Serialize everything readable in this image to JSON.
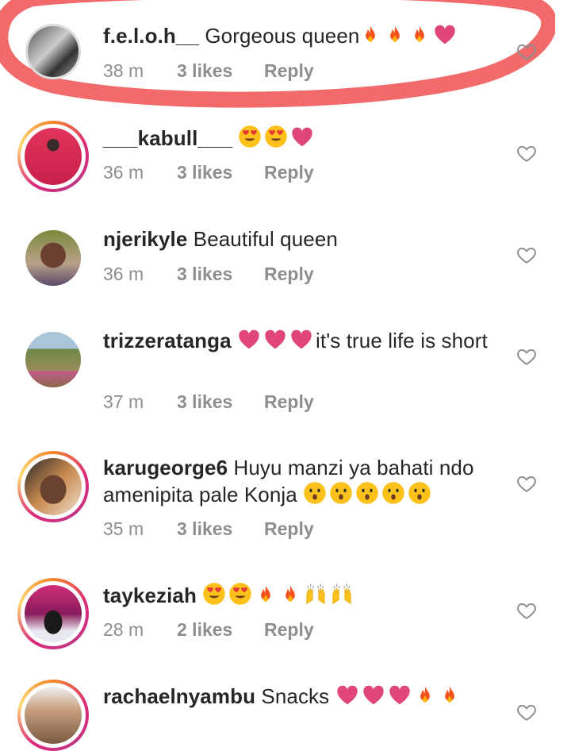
{
  "comments": [
    {
      "username": "f.e.l.o.h__",
      "text": "Gorgeous queen",
      "emojis": [
        "fire-emoji",
        "fire-emoji",
        "fire-emoji",
        "pink-heart-emoji"
      ],
      "time": "38 m",
      "likes": "3 likes",
      "reply": "Reply",
      "avatar_icon": "profile-photo-bw"
    },
    {
      "username": "___kabull___",
      "text": "",
      "emojis": [
        "heart-eyes-emoji",
        "heart-eyes-emoji",
        "pink-heart-emoji"
      ],
      "time": "36 m",
      "likes": "3 likes",
      "reply": "Reply",
      "avatar_icon": "profile-photo-pink"
    },
    {
      "username": "njerikyle",
      "text": "Beautiful queen",
      "emojis": [],
      "time": "36 m",
      "likes": "3 likes",
      "reply": "Reply",
      "avatar_icon": "profile-photo-selfie"
    },
    {
      "username": "trizzeratanga",
      "text_before": "",
      "emojis": [
        "pink-heart-emoji",
        "pink-heart-emoji",
        "pink-heart-emoji"
      ],
      "text": "it's true life is short",
      "time": "37 m",
      "likes": "3 likes",
      "reply": "Reply",
      "avatar_icon": "profile-photo-outdoor"
    },
    {
      "username": "karugeorge6",
      "text": "Huyu manzi ya bahati  ndo amenipita pale Konja",
      "emojis": [
        "hushed-face-emoji",
        "hushed-face-emoji",
        "hushed-face-emoji",
        "hushed-face-emoji",
        "hushed-face-emoji"
      ],
      "time": "35 m",
      "likes": "3 likes",
      "reply": "Reply",
      "avatar_icon": "profile-photo-man"
    },
    {
      "username": "taykeziah",
      "text": "",
      "emojis": [
        "heart-eyes-emoji",
        "heart-eyes-emoji",
        "fire-emoji",
        "fire-emoji",
        "raising-hands-emoji",
        "raising-hands-emoji"
      ],
      "time": "28 m",
      "likes": "2 likes",
      "reply": "Reply",
      "avatar_icon": "profile-photo-purple"
    },
    {
      "username": "rachaelnyambu",
      "text": "Snacks",
      "emojis": [
        "pink-heart-emoji",
        "pink-heart-emoji",
        "pink-heart-emoji",
        "fire-emoji",
        "fire-emoji"
      ],
      "time": "",
      "likes": "",
      "reply": "",
      "avatar_icon": "profile-photo-group"
    }
  ],
  "colors": {
    "text": "#262626",
    "meta": "#8e8e8e",
    "highlight": "#f26a6a",
    "heart_emoji": "#e0457b"
  }
}
